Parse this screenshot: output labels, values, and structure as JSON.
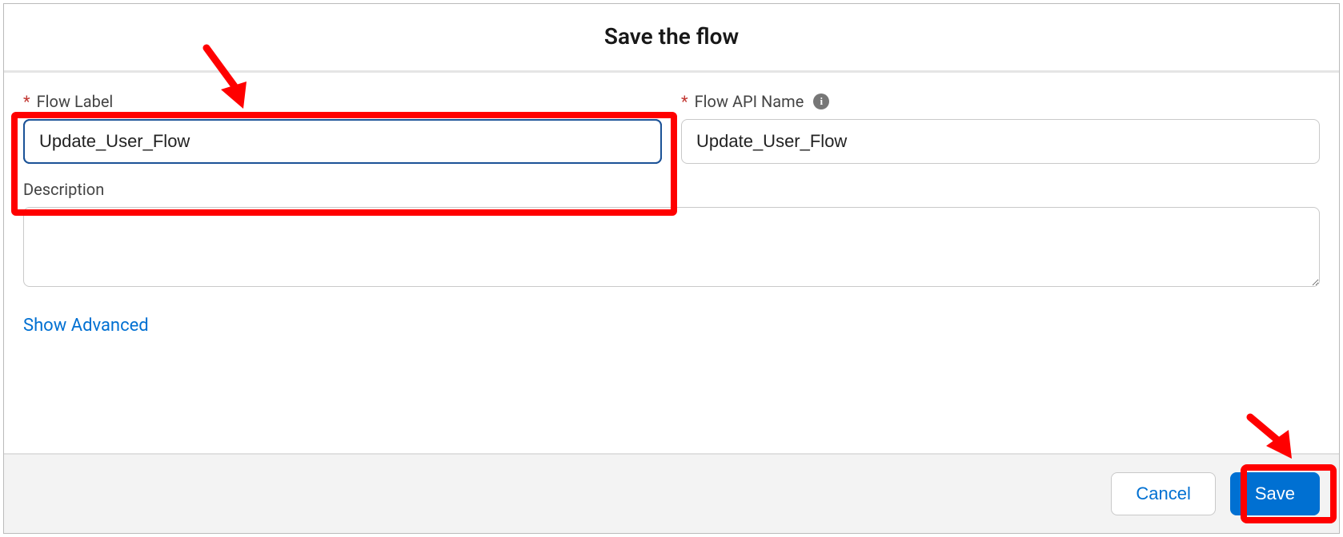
{
  "modal": {
    "title": "Save the flow"
  },
  "form": {
    "flowLabel": {
      "label": "Flow Label",
      "value": "Update_User_Flow",
      "required": "*"
    },
    "flowApiName": {
      "label": "Flow API Name",
      "value": "Update_User_Flow",
      "required": "*"
    },
    "description": {
      "label": "Description",
      "value": ""
    }
  },
  "links": {
    "showAdvanced": "Show Advanced"
  },
  "buttons": {
    "cancel": "Cancel",
    "save": "Save"
  },
  "colors": {
    "accent": "#0070d2",
    "required": "#c23934",
    "annotation": "#ff0000"
  }
}
